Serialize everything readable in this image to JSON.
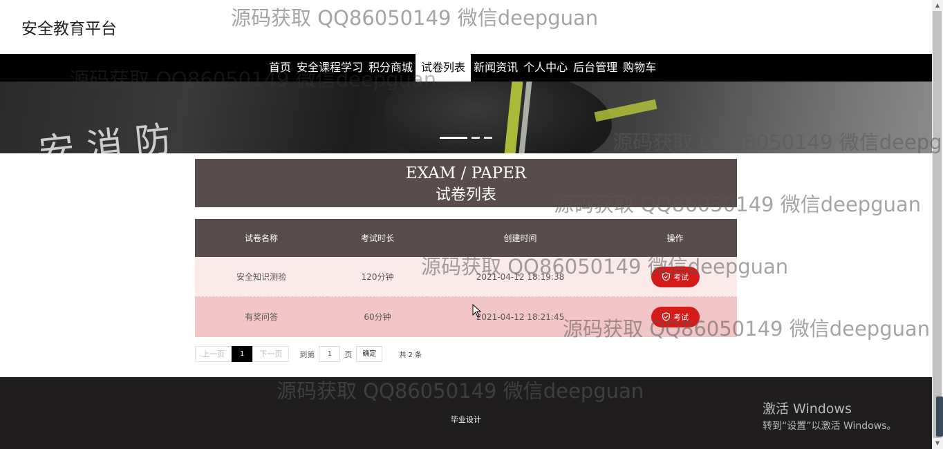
{
  "header": {
    "site_title": "安全教育平台"
  },
  "nav": {
    "items": [
      {
        "label": "首页"
      },
      {
        "label": "安全课程学习"
      },
      {
        "label": "积分商城"
      },
      {
        "label": "试卷列表"
      },
      {
        "label": "新闻资讯"
      },
      {
        "label": "个人中心"
      },
      {
        "label": "后台管理"
      },
      {
        "label": "购物车"
      }
    ],
    "active": "试卷列表"
  },
  "banner": {
    "text": "安消防",
    "slide_count": 3,
    "active_slide": 1
  },
  "section": {
    "title_en": "EXAM / PAPER",
    "title_cn": "试卷列表"
  },
  "table": {
    "headers": [
      "试卷名称",
      "考试时长",
      "创建时间",
      "操作"
    ],
    "rows": [
      {
        "name": "安全知识测验",
        "duration": "120分钟",
        "created": "2021-04-12 18:19:38",
        "action": "考试"
      },
      {
        "name": "有奖问答",
        "duration": "60分钟",
        "created": "2021-04-12 18:21:45",
        "action": "考试"
      }
    ]
  },
  "pagination": {
    "prev": "上一页",
    "current": "1",
    "next": "下一页",
    "goto_label": "到第",
    "goto_value": "1",
    "page_suffix": "页",
    "confirm": "确定",
    "total": "共 2 条"
  },
  "footer": {
    "text": "毕业设计"
  },
  "watermark": {
    "text": "源码获取 QQ86050149 微信deepguan"
  },
  "os_overlay": {
    "line1": "激活 Windows",
    "line2": "转到“设置”以激活 Windows。"
  },
  "colors": {
    "nav_bg": "#000000",
    "panel_bg": "#584c4c",
    "button_red": "#d61b1b",
    "row1": "#fbeaea",
    "row2": "#f2c6c6",
    "footer_bg": "#1f1d1d"
  }
}
